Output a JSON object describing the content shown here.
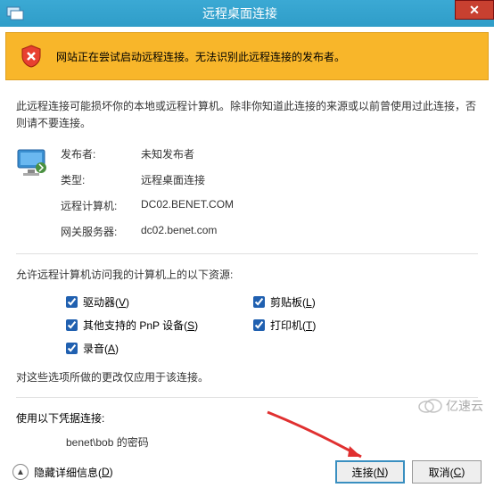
{
  "window": {
    "title": "远程桌面连接",
    "close_label": "✕"
  },
  "warning": {
    "message": "网站正在尝试启动远程连接。无法识别此远程连接的发布者。"
  },
  "description": "此远程连接可能损坏你的本地或远程计算机。除非你知道此连接的来源或以前曾使用过此连接，否则请不要连接。",
  "info": {
    "publisher_label": "发布者:",
    "publisher_value": "未知发布者",
    "type_label": "类型:",
    "type_value": "远程桌面连接",
    "remote_label": "远程计算机:",
    "remote_value": "DC02.BENET.COM",
    "gateway_label": "网关服务器:",
    "gateway_value": "dc02.benet.com"
  },
  "resources": {
    "heading": "允许远程计算机访问我的计算机上的以下资源:",
    "drives": {
      "label": "驱动器(",
      "hotkey": "V",
      "suffix": ")",
      "checked": true
    },
    "clipboard": {
      "label": "剪贴板(",
      "hotkey": "L",
      "suffix": ")",
      "checked": true
    },
    "pnp": {
      "label": "其他支持的 PnP 设备(",
      "hotkey": "S",
      "suffix": ")",
      "checked": true
    },
    "printers": {
      "label": "打印机(",
      "hotkey": "T",
      "suffix": ")",
      "checked": true
    },
    "audio": {
      "label": "录音(",
      "hotkey": "A",
      "suffix": ")",
      "checked": true
    }
  },
  "note": "对这些选项所做的更改仅应用于该连接。",
  "credentials": {
    "heading": "使用以下凭据连接:",
    "value": "benet\\bob 的密码"
  },
  "footer": {
    "collapse": {
      "label": "隐藏详细信息(",
      "hotkey": "D",
      "suffix": ")"
    },
    "connect": {
      "label": "连接(",
      "hotkey": "N",
      "suffix": ")"
    },
    "cancel": {
      "label": "取消(",
      "hotkey": "C",
      "suffix": ")"
    }
  },
  "watermark": "亿速云"
}
